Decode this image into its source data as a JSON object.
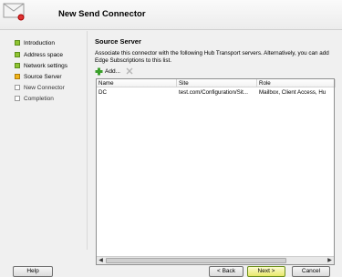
{
  "header": {
    "title": "New Send Connector"
  },
  "nav": {
    "items": [
      {
        "label": "Introduction",
        "state": "done"
      },
      {
        "label": "Address space",
        "state": "done"
      },
      {
        "label": "Network settings",
        "state": "done"
      },
      {
        "label": "Source Server",
        "state": "current"
      },
      {
        "label": "New Connector",
        "state": "pending"
      },
      {
        "label": "Completion",
        "state": "pending"
      }
    ]
  },
  "main": {
    "section_title": "Source Server",
    "description": "Associate this connector with the following Hub Transport servers. Alternatively, you can add Edge Subscriptions to this list.",
    "toolbar": {
      "add_label": "Add..."
    },
    "grid": {
      "columns": [
        "Name",
        "Site",
        "Role"
      ],
      "rows": [
        [
          "DC",
          "test.com/Configuration/Sit...",
          "Mailbox, Client Access, Hu"
        ]
      ]
    }
  },
  "footer": {
    "help_label": "Help",
    "back_label": "< Back",
    "next_label": "Next >",
    "cancel_label": "Cancel"
  },
  "colors": {
    "done": "#8fc431",
    "current": "#f0b419",
    "pending": "#ffffff"
  },
  "icons": {
    "header": "envelope-icon",
    "add": "plus-icon",
    "remove": "x-icon"
  }
}
